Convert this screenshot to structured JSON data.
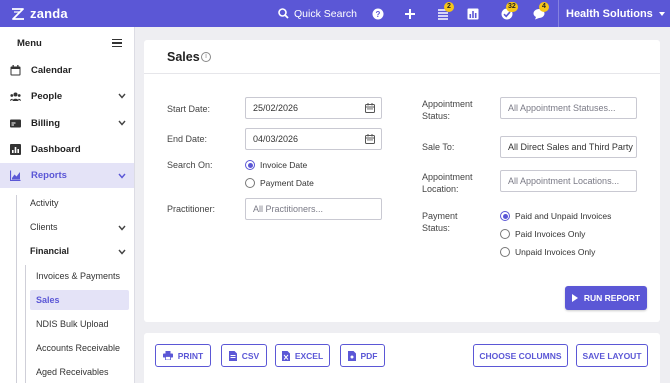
{
  "topbar": {
    "brand": "zanda",
    "quick_search": "Quick Search",
    "badges": {
      "tasks": "2",
      "approvals": "32",
      "messages": "4"
    },
    "org_name": "Health Solutions",
    "icons": [
      "search-icon",
      "help-icon",
      "plus-icon",
      "tasks-icon",
      "chart-icon",
      "approvals-icon",
      "messages-icon"
    ],
    "accent": "#5b57d6"
  },
  "sidebar": {
    "menu_label": "Menu",
    "items": [
      {
        "label": "Calendar",
        "icon": "calendar-icon"
      },
      {
        "label": "People",
        "icon": "people-icon"
      },
      {
        "label": "Billing",
        "icon": "billing-icon"
      },
      {
        "label": "Dashboard",
        "icon": "dashboard-icon"
      },
      {
        "label": "Reports",
        "icon": "reports-icon"
      }
    ],
    "reports_sub": [
      "Activity",
      "Clients",
      "Financial"
    ],
    "financial_sub": [
      "Invoices & Payments",
      "Sales",
      "NDIS Bulk Upload",
      "Accounts Receivable",
      "Aged Receivables"
    ]
  },
  "sales": {
    "title": "Sales",
    "info_icon": "i",
    "start_date_label": "Start Date:",
    "start_date": "25/02/2026",
    "end_date_label": "End Date:",
    "end_date": "04/03/2026",
    "search_on_label": "Search On:",
    "search_on_options": [
      "Invoice Date",
      "Payment Date"
    ],
    "practitioner_label": "Practitioner:",
    "practitioner_placeholder": "All Practitioners...",
    "appt_status_label": "Appointment Status:",
    "appt_status_placeholder": "All Appointment Statuses...",
    "sale_to_label": "Sale To:",
    "sale_to_value": "All Direct Sales and Third Party",
    "appt_location_label": "Appointment Location:",
    "appt_location_placeholder": "All Appointment Locations...",
    "payment_status_label": "Payment Status:",
    "payment_status_options": [
      "Paid and Unpaid Invoices",
      "Paid Invoices Only",
      "Unpaid Invoices Only"
    ],
    "run_report": "RUN REPORT"
  },
  "toolbar": {
    "print": "PRINT",
    "csv": "CSV",
    "excel": "EXCEL",
    "pdf": "PDF",
    "choose_columns": "CHOOSE COLUMNS",
    "save_layout": "SAVE LAYOUT"
  }
}
